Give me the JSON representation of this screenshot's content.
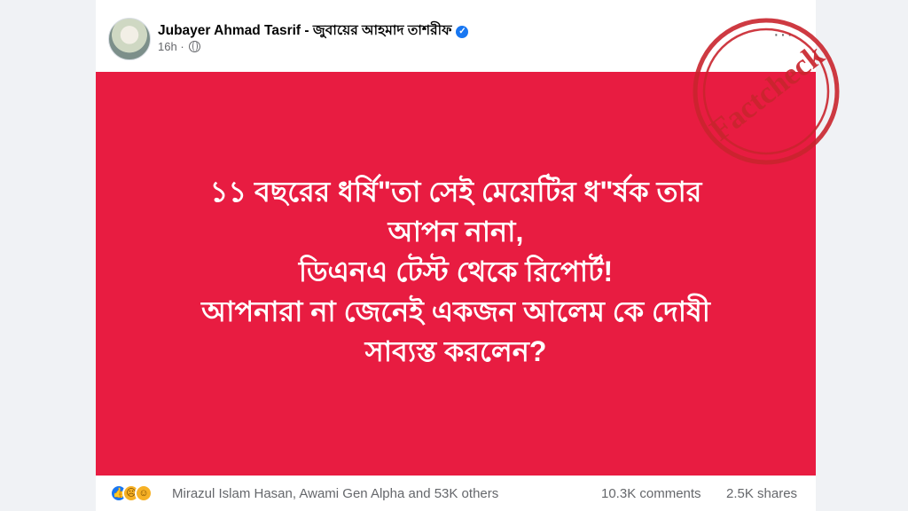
{
  "post": {
    "author": "Jubayer Ahmad Tasrif - জুবায়ের আহমাদ তাশরীফ",
    "verified_icon": "verified-badge-icon",
    "time": "16h",
    "audience_icon": "globe-icon",
    "more_label": "···"
  },
  "banner": {
    "background": "#e81c41",
    "lines": [
      "১১ বছরের ধর্ষি\"তা সেই মেয়েটির ধ\"র্ষক তার",
      "আপন নানা,",
      "ডিএনএ টেস্ট থেকে রিপোর্ট!",
      "আপনারা না জেনেই একজন আলেম কে দোষী",
      "সাব্যস্ত করলেন?"
    ]
  },
  "stamp": {
    "text": "Factcheck",
    "color": "#c9252e"
  },
  "footer": {
    "reactions": [
      "like-icon",
      "sad-icon",
      "haha-icon"
    ],
    "reactors": "Mirazul Islam Hasan, Awami Gen Alpha and 53K others",
    "comments": "10.3K comments",
    "shares": "2.5K shares"
  }
}
